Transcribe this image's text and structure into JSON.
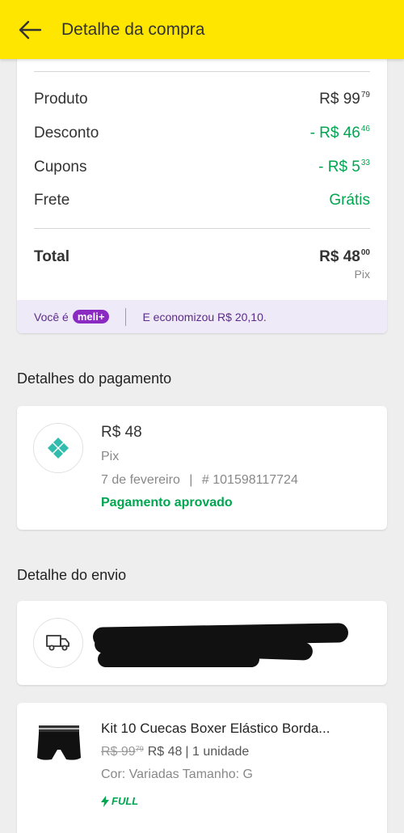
{
  "header": {
    "title": "Detalhe da compra",
    "background_color": "#ffe600"
  },
  "summary": {
    "rows": [
      {
        "label": "Produto",
        "value_main": "R$ 99",
        "value_cents": "79",
        "color": "#333333"
      },
      {
        "label": "Desconto",
        "value_main": "- R$ 46",
        "value_cents": "46",
        "color": "#00a650"
      },
      {
        "label": "Cupons",
        "value_main": "- R$ 5",
        "value_cents": "33",
        "color": "#00a650"
      },
      {
        "label": "Frete",
        "value_main": "Grátis",
        "value_cents": "",
        "color": "#00a650"
      }
    ],
    "total_label": "Total",
    "total_main": "R$ 48",
    "total_cents": "00",
    "total_method": "Pix"
  },
  "meli": {
    "prefix": "Você é",
    "badge": "meli+",
    "savings": "E economizou R$ 20,10."
  },
  "payment": {
    "section_title": "Detalhes do pagamento",
    "amount": "R$ 48",
    "method": "Pix",
    "date": "7 de fevereiro",
    "separator": "|",
    "operation": "# 101598117724",
    "status": "Pagamento aprovado",
    "icon": "pix-icon"
  },
  "shipping": {
    "section_title": "Detalhe do envio",
    "icon": "truck-icon"
  },
  "product": {
    "title": "Kit 10 Cuecas Boxer Elástico Borda...",
    "old_price_main": "R$ 99",
    "old_price_cents": "79",
    "price": "R$ 48",
    "quantity": "| 1 unidade",
    "variant": "Cor: Variadas Tamanho: G",
    "shipping_badge": "FULL"
  }
}
